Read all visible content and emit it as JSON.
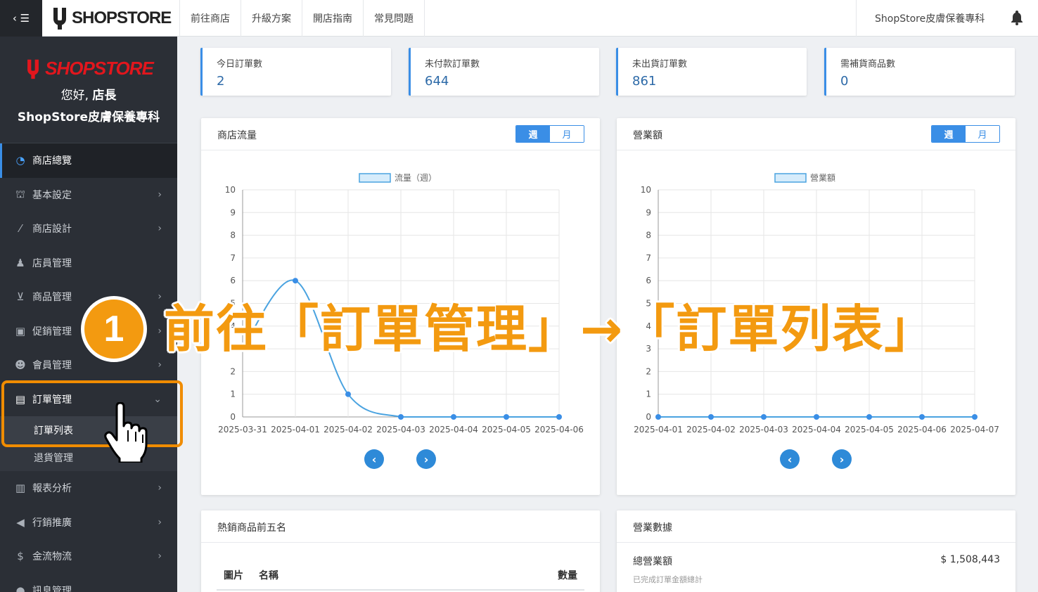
{
  "topbar": {
    "toggle": "‹ ☰",
    "logo": "SHOPSTORE",
    "nav": [
      "前往商店",
      "升級方案",
      "開店指南",
      "常見問題"
    ],
    "store_name": "ShopStore皮膚保養專科"
  },
  "sidebar": {
    "logo": "SHOPSTORE",
    "greeting_prefix": "您好, ",
    "greeting_role": "店長",
    "store_name": "ShopStore皮膚保養專科",
    "items": [
      {
        "label": "商店總覽",
        "icon": "dashboard-icon"
      },
      {
        "label": "基本設定",
        "icon": "bank-icon"
      },
      {
        "label": "商店設計",
        "icon": "magic-wand-icon"
      },
      {
        "label": "店員管理",
        "icon": "staff-icon"
      },
      {
        "label": "商品管理",
        "icon": "cart-icon"
      },
      {
        "label": "促銷管理",
        "icon": "gift-icon"
      },
      {
        "label": "會員管理",
        "icon": "users-icon"
      },
      {
        "label": "訂單管理",
        "icon": "orders-icon"
      },
      {
        "label": "報表分析",
        "icon": "bar-chart-icon"
      },
      {
        "label": "行銷推廣",
        "icon": "megaphone-icon"
      },
      {
        "label": "金流物流",
        "icon": "dollar-icon"
      },
      {
        "label": "訊息管理",
        "icon": "chat-icon"
      }
    ],
    "sub_items": [
      "訂單列表",
      "退貨管理"
    ]
  },
  "stats": [
    {
      "label": "今日訂單數",
      "value": "2"
    },
    {
      "label": "未付款訂單數",
      "value": "644"
    },
    {
      "label": "未出貨訂單數",
      "value": "861"
    },
    {
      "label": "需補貨商品數",
      "value": "0"
    }
  ],
  "traffic_panel": {
    "title": "商店流量",
    "week": "週",
    "month": "月"
  },
  "sales_panel": {
    "title": "營業額",
    "week": "週",
    "month": "月"
  },
  "top_products": {
    "title": "熱銷商品前五名",
    "col_image": "圖片",
    "col_name": "名稱",
    "col_qty": "數量"
  },
  "business": {
    "title": "營業數據",
    "total_label": "總營業額",
    "total_value": "$ 1,508,443",
    "total_note": "已完成訂單金額總計"
  },
  "annotation": {
    "step": "1",
    "text": "前往「訂單管理」→「訂單列表」"
  },
  "colors": {
    "accent": "#3a8ee6",
    "annotation": "#f39a10",
    "brand_red": "#e2161d"
  },
  "chart_data": [
    {
      "type": "line",
      "legend": "流量（週）",
      "x": [
        "2025-03-31",
        "2025-04-01",
        "2025-04-02",
        "2025-04-03",
        "2025-04-04",
        "2025-04-05",
        "2025-04-06"
      ],
      "series": [
        {
          "name": "流量（週）",
          "values": [
            3,
            6,
            1,
            0,
            0,
            0,
            0
          ]
        }
      ],
      "ylim": [
        0,
        10
      ],
      "yticks": [
        0,
        1,
        2,
        3,
        4,
        5,
        6,
        7,
        8,
        9,
        10
      ],
      "grid": true,
      "legend_position": "top"
    },
    {
      "type": "line",
      "legend": "營業額",
      "x": [
        "2025-04-01",
        "2025-04-02",
        "2025-04-03",
        "2025-04-04",
        "2025-04-05",
        "2025-04-06",
        "2025-04-07"
      ],
      "series": [
        {
          "name": "營業額",
          "values": [
            0,
            0,
            0,
            0,
            0,
            0,
            0
          ]
        }
      ],
      "ylim": [
        0,
        10
      ],
      "yticks": [
        0,
        1,
        2,
        3,
        4,
        5,
        6,
        7,
        8,
        9,
        10
      ],
      "grid": true,
      "legend_position": "top"
    }
  ]
}
